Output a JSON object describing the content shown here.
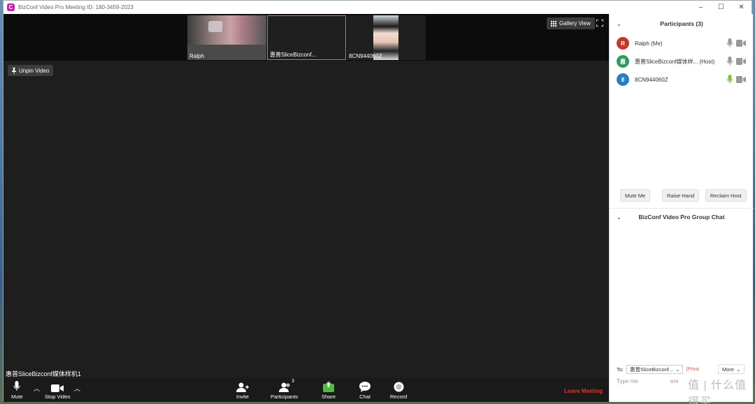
{
  "window": {
    "title": "BizConf Video Pro Meeting ID: 180-3459-2023",
    "controls": [
      "–",
      "☐",
      "✕"
    ]
  },
  "video": {
    "thumbnails": [
      {
        "name": "Ralph"
      },
      {
        "name": "惠普SliceBizconf..."
      },
      {
        "name": "8CN944060Z"
      }
    ],
    "gallery_view_label": "Gallery View",
    "unpin_label": "Unpin Video",
    "active_speaker": "惠普SliceBizconf媒体样机1"
  },
  "toolbar": {
    "mute": "Mute",
    "stop_video": "Stop Video",
    "invite": "Invite",
    "participants": "Participants",
    "participants_count": "3",
    "share": "Share",
    "chat": "Chat",
    "record": "Record",
    "leave": "Leave Meeting"
  },
  "panel": {
    "participants_title": "Participants (3)",
    "participants": [
      {
        "initial": "R",
        "name": "Ralph (Me)",
        "color": "#c0392b",
        "mic": "muted",
        "mic_color": "#999999"
      },
      {
        "initial": "惠",
        "name": "惠普SliceBizconf媒体样... (Host)",
        "color": "#2e9b5b",
        "mic": "muted",
        "mic_color": "#999999"
      },
      {
        "initial": "8",
        "name": "8CN944060Z",
        "color": "#2a7ec0",
        "mic": "active",
        "mic_color": "#7cc43f"
      }
    ],
    "buttons": {
      "mute_me": "Mute Me",
      "raise_hand": "Raise Hand",
      "reclaim_host": "Reclaim Host"
    },
    "chat_title": "BizConf Video Pro Group Chat",
    "chat_to_label": "To:",
    "chat_to_value": "惠普SliceBizconf...",
    "chat_privately": "(Priva",
    "chat_more": "More",
    "chat_placeholder": "Type me",
    "chat_placeholder_tail": "ere",
    "watermark": "值 | 什么值得买"
  },
  "colors": {
    "accent_green": "#7fa54a",
    "leave_red": "#e0352b",
    "brand": "#c21fa8"
  }
}
